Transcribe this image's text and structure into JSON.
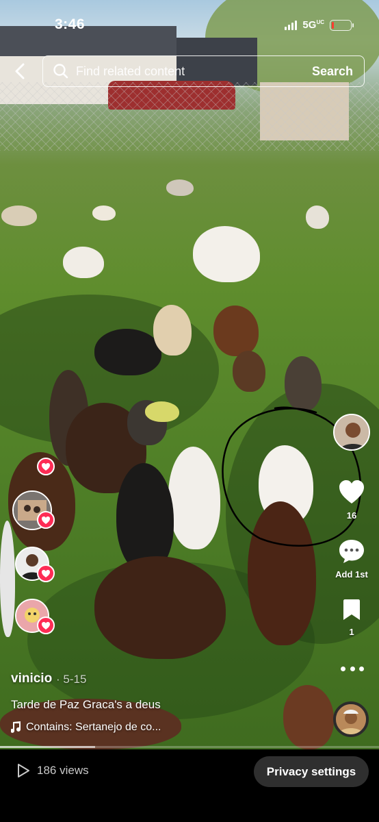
{
  "status_bar": {
    "time": "3:46",
    "network": "5G",
    "network_superscript": "UC",
    "battery_color": "#ff3b30",
    "battery_level": 0.12
  },
  "search": {
    "placeholder": "Find related content",
    "button_label": "Search"
  },
  "video": {
    "annotation_color": "#000000",
    "progress": 0.25
  },
  "actions": {
    "like_count": "16",
    "comment_label": "Add 1st",
    "favorite_count": "1",
    "accent": "#fe2c55"
  },
  "post": {
    "username": "vinicio",
    "date": "· 5-15",
    "caption": "Tarde de Paz Graca's a deus",
    "music": "Contains: Sertanejo de co..."
  },
  "footer": {
    "views": "186 views",
    "privacy_button": "Privacy settings"
  },
  "icons": [
    "back-arrow-icon",
    "search-icon",
    "heart-icon",
    "comment-icon",
    "bookmark-icon",
    "more-icon",
    "music-note-icon",
    "play-icon"
  ]
}
